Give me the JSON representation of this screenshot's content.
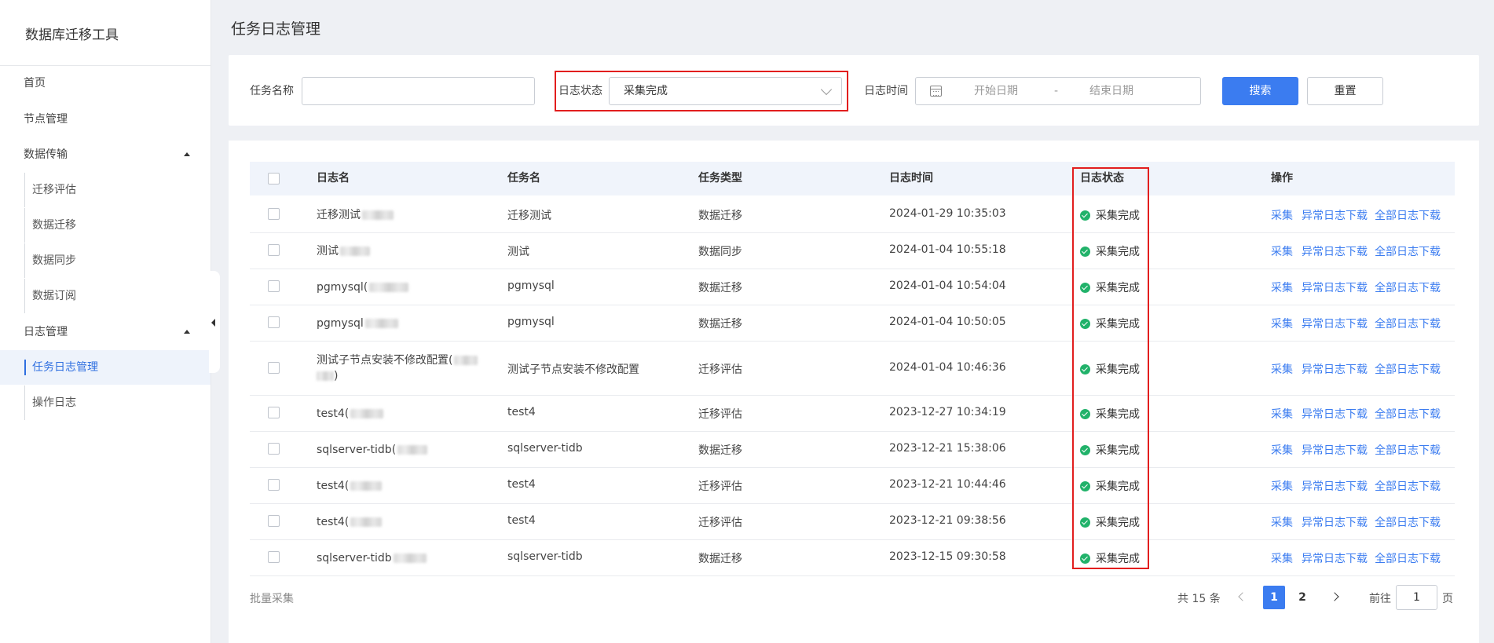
{
  "app": {
    "title": "数据库迁移工具"
  },
  "sidebar": {
    "items": [
      {
        "label": "首页"
      },
      {
        "label": "节点管理"
      },
      {
        "label": "数据传输",
        "expanded": true
      },
      {
        "label": "迁移评估"
      },
      {
        "label": "数据迁移"
      },
      {
        "label": "数据同步"
      },
      {
        "label": "数据订阅"
      },
      {
        "label": "日志管理",
        "expanded": true
      },
      {
        "label": "任务日志管理",
        "active": true
      },
      {
        "label": "操作日志"
      }
    ]
  },
  "page": {
    "title": "任务日志管理"
  },
  "search": {
    "task_name_label": "任务名称",
    "task_name_value": "",
    "log_status_label": "日志状态",
    "log_status_value": "采集完成",
    "log_time_label": "日志时间",
    "start_placeholder": "开始日期",
    "separator": "-",
    "end_placeholder": "结束日期",
    "search_button": "搜索",
    "reset_button": "重置"
  },
  "table": {
    "columns": [
      "日志名",
      "任务名",
      "任务类型",
      "日志时间",
      "日志状态",
      "操作"
    ],
    "actions": [
      "采集",
      "异常日志下载",
      "全部日志下载"
    ],
    "rows": [
      {
        "log_name": "迁移测试",
        "log_name_line2": "",
        "task": "迁移测试",
        "type": "数据迁移",
        "time": "2024-01-29 10:35:03",
        "status": "采集完成"
      },
      {
        "log_name": "测试",
        "log_name_line2": "",
        "task": "测试",
        "type": "数据同步",
        "time": "2024-01-04 10:55:18",
        "status": "采集完成"
      },
      {
        "log_name": "pgmysql(",
        "log_name_line2": "",
        "task": "pgmysql",
        "type": "数据迁移",
        "time": "2024-01-04 10:54:04",
        "status": "采集完成"
      },
      {
        "log_name": "pgmysql",
        "log_name_line2": "",
        "task": "pgmysql",
        "type": "数据迁移",
        "time": "2024-01-04 10:50:05",
        "status": "采集完成"
      },
      {
        "log_name": "测试子节点安装不修改配置(",
        "log_name_line2": ")",
        "task": "测试子节点安装不修改配置",
        "type": "迁移评估",
        "time": "2024-01-04 10:46:36",
        "status": "采集完成"
      },
      {
        "log_name": "test4(",
        "log_name_line2": "",
        "task": "test4",
        "type": "迁移评估",
        "time": "2023-12-27 10:34:19",
        "status": "采集完成"
      },
      {
        "log_name": "sqlserver-tidb(",
        "log_name_line2": "",
        "task": "sqlserver-tidb",
        "type": "数据迁移",
        "time": "2023-12-21 15:38:06",
        "status": "采集完成"
      },
      {
        "log_name": "test4(",
        "log_name_line2": "",
        "task": "test4",
        "type": "迁移评估",
        "time": "2023-12-21 10:44:46",
        "status": "采集完成"
      },
      {
        "log_name": "test4(",
        "log_name_line2": "",
        "task": "test4",
        "type": "迁移评估",
        "time": "2023-12-21 09:38:56",
        "status": "采集完成"
      },
      {
        "log_name": "sqlserver-tidb",
        "log_name_line2": "",
        "task": "sqlserver-tidb",
        "type": "数据迁移",
        "time": "2023-12-15 09:30:58",
        "status": "采集完成"
      }
    ]
  },
  "footer": {
    "batch_label": "批量采集",
    "total": "共 15 条",
    "pages": [
      "1",
      "2"
    ],
    "current_page": "1",
    "goto_label": "前往",
    "goto_value": "1",
    "page_suffix": "页"
  },
  "colors": {
    "primary": "#3b7cf0",
    "success": "#21b26a",
    "highlight": "#e21e1e"
  }
}
